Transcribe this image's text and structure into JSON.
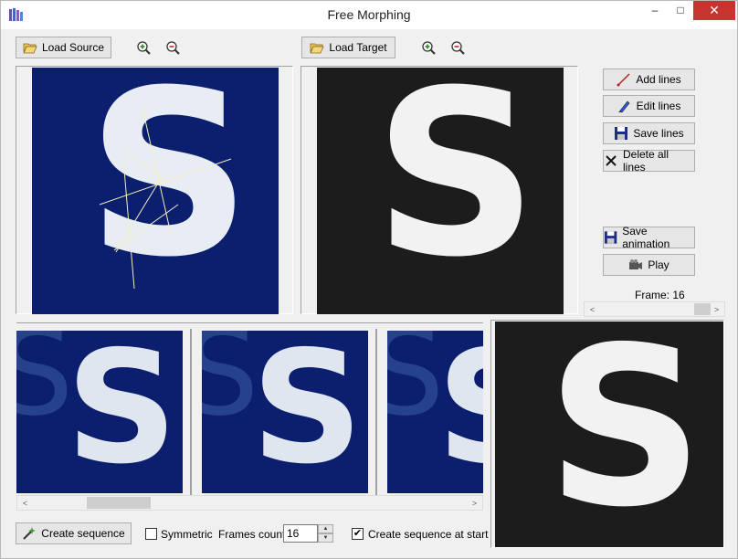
{
  "window": {
    "title": "Free Morphing",
    "minimize_glyph": "–",
    "maximize_glyph": "□",
    "close_glyph": "✕"
  },
  "source": {
    "load_label": "Load Source",
    "letter": "S"
  },
  "target": {
    "load_label": "Load Target",
    "letter": "S"
  },
  "side_buttons": {
    "add_lines": "Add lines",
    "edit_lines": "Edit lines",
    "save_lines": "Save lines",
    "delete_all_lines": "Delete all lines",
    "save_animation": "Save animation",
    "play": "Play"
  },
  "frame_label": "Frame: 16",
  "frame_slider": {
    "value": 16,
    "max": 16
  },
  "thumbnails": [
    {
      "text": "S",
      "ghost": "S"
    },
    {
      "text": "S",
      "ghost": "S"
    },
    {
      "text": "S",
      "ghost": "S"
    }
  ],
  "preview_letter": "S",
  "bottom": {
    "create_sequence_label": "Create sequence",
    "symmetric_label": "Symmetric",
    "symmetric_checked": false,
    "frames_count_label": "Frames count:",
    "frames_count_value": "16",
    "create_at_start_label": "Create sequence at start",
    "create_at_start_checked": true,
    "check_glyph": "✔"
  },
  "scroll": {
    "left_arrow": "<",
    "right_arrow": ">"
  },
  "colors": {
    "navy": "#0b1f6e",
    "dark_bg": "#1c1c1c",
    "letter_light": "#e8ecf4",
    "close_red": "#c7332f"
  }
}
